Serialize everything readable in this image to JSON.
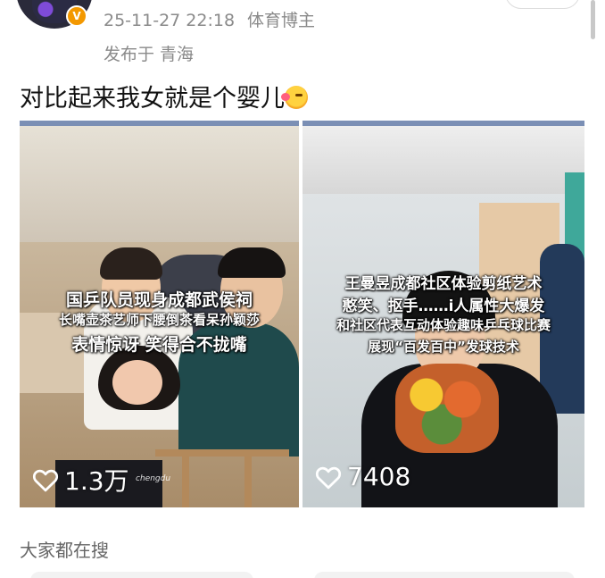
{
  "post": {
    "timestamp": "25-11-27 22:18",
    "author_role": "体育博主",
    "location": "发布于 青海",
    "text": "对比起来我女就是个婴儿",
    "verified_badge": "V"
  },
  "cards": [
    {
      "captions": [
        "国乒队员现身成都武侯祠",
        "长嘴壶茶艺师下腰倒茶看呆孙颖莎",
        "表情惊讶 笑得合不拢嘴"
      ],
      "likes": "1.3万",
      "watermark": "chengdu"
    },
    {
      "captions": [
        "王曼昱成都社区体验剪纸艺术",
        "憨笑、抠手……i人属性大爆发",
        "和社区代表互动体验趣味乒乓球比赛",
        "展现“百发百中”发球技术"
      ],
      "likes": "7408"
    }
  ],
  "sections": {
    "trending_label": "大家都在搜"
  },
  "icons": {
    "like": "heart-outline-icon",
    "emoji": "kiss-face-emoji-icon"
  },
  "colors": {
    "meta_text": "#8a8a8a",
    "verified": "#f39800",
    "body_text": "#111111"
  }
}
